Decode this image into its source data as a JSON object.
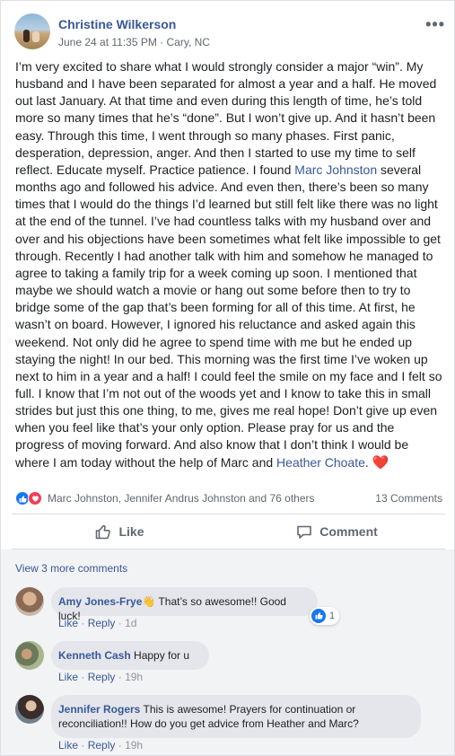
{
  "post": {
    "author": "Christine Wilkerson",
    "meta": "June 24 at 11:35 PM · Cary, NC",
    "more_icon": "more-options-icon",
    "text_1": "I’m very excited to share what I would strongly consider a major “win”. My husband and I have been separated for almost a year and a half. He moved out last January. At that time and even during this length of time, he’s told more so many times that he’s “done”. But I won’t give up. And it hasn’t been easy. Through this time, I went through so many phases. First panic, desperation, depression, anger. And then I started to use my time to self reflect. Educate myself. Practice patience. I found ",
    "link_1": "Marc Johnston",
    "text_2": " several months ago and followed his advice. And even then, there’s been so many times that I would do the things I’d learned but still felt like there was no light at the end of the tunnel. I’ve had countless talks with my husband over and over and his objections have been sometimes what felt like impossible to get through. Recently I had another talk with him and somehow he managed to agree to taking a family trip for a week coming up soon. I mentioned that maybe we should watch a movie or hang out some before then to try to bridge some of the gap that’s been forming for all of this time. At first, he wasn’t on board. However, I ignored his reluctance and asked again this weekend. Not only did he agree to spend time with me but he ended up staying the night! In our bed. This morning was the first time I’ve woken up next to him in a year and a half! I could feel the smile on my face and I felt so full. I know that I’m not out of the woods yet and I know to take this in small strides but just this one thing, to me, gives me real hope! Don’t give up even when you feel like that’s your only option. Please pray for us and the progress of moving forward. And also know that I don’t think I would be where I am today without the help of Marc and ",
    "link_2": "Heather Choate",
    "text_3": ".",
    "heart": "❤️"
  },
  "reactions": {
    "names": "Marc Johnston, Jennifer Andrus Johnston and 76 others",
    "comments_count": "13 Comments"
  },
  "actions": {
    "like_label": "Like",
    "comment_label": "Comment"
  },
  "comments_section": {
    "view_more": "View 3 more comments",
    "comments": [
      {
        "name": "Amy Jones-Frye",
        "emoji": "👋",
        "text": "That’s so awesome!! Good luck!",
        "like": "Like",
        "reply": "Reply",
        "time": "1d",
        "like_count": "1"
      },
      {
        "name": "Kenneth Cash",
        "text": "Happy for u",
        "like": "Like",
        "reply": "Reply",
        "time": "19h"
      },
      {
        "name": "Jennifer Rogers",
        "text": "This is awesome! Prayers for continuation or reconciliation!! How do you get advice from Heather and Marc?",
        "like": "Like",
        "reply": "Reply",
        "time": "19h"
      }
    ]
  },
  "colors": {
    "link": "#385898",
    "secondary_text": "#606770",
    "like_blue": "#1877f2",
    "love_red": "#f33e58",
    "bubble_bg": "#e4e6eb",
    "comments_bg": "#f2f3f5"
  }
}
